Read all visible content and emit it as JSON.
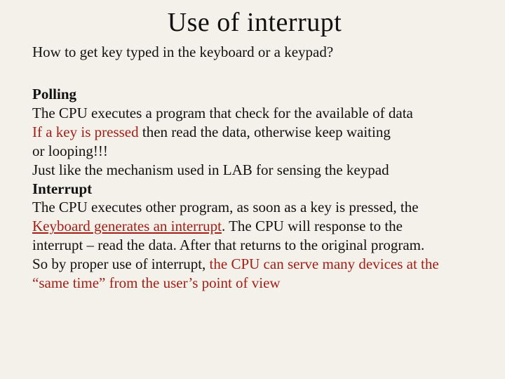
{
  "title": "Use of interrupt",
  "intro": "How to get key typed in the keyboard or a keypad?",
  "polling_head": "Polling",
  "polling_l1": "The CPU executes a program that check for the available of data",
  "polling_l2a": "If a key is pressed",
  "polling_l2b": " then read the data, otherwise keep waiting",
  "polling_l3": "or looping!!!",
  "polling_l4": "Just like the mechanism used in LAB for sensing the keypad",
  "interrupt_head": "Interrupt",
  "interrupt_l1": "The CPU executes other program, as soon as a key is pressed, the",
  "interrupt_l2a": "Keyboard generates an interrupt",
  "interrupt_l2b": ". The CPU will response to the",
  "interrupt_l3": "interrupt – read the data. After that returns to the original program.",
  "interrupt_l4a": "So by proper use of interrupt, ",
  "interrupt_l4b": "the CPU can serve many devices at the",
  "interrupt_l5": "“same time” from the user’s point of view"
}
